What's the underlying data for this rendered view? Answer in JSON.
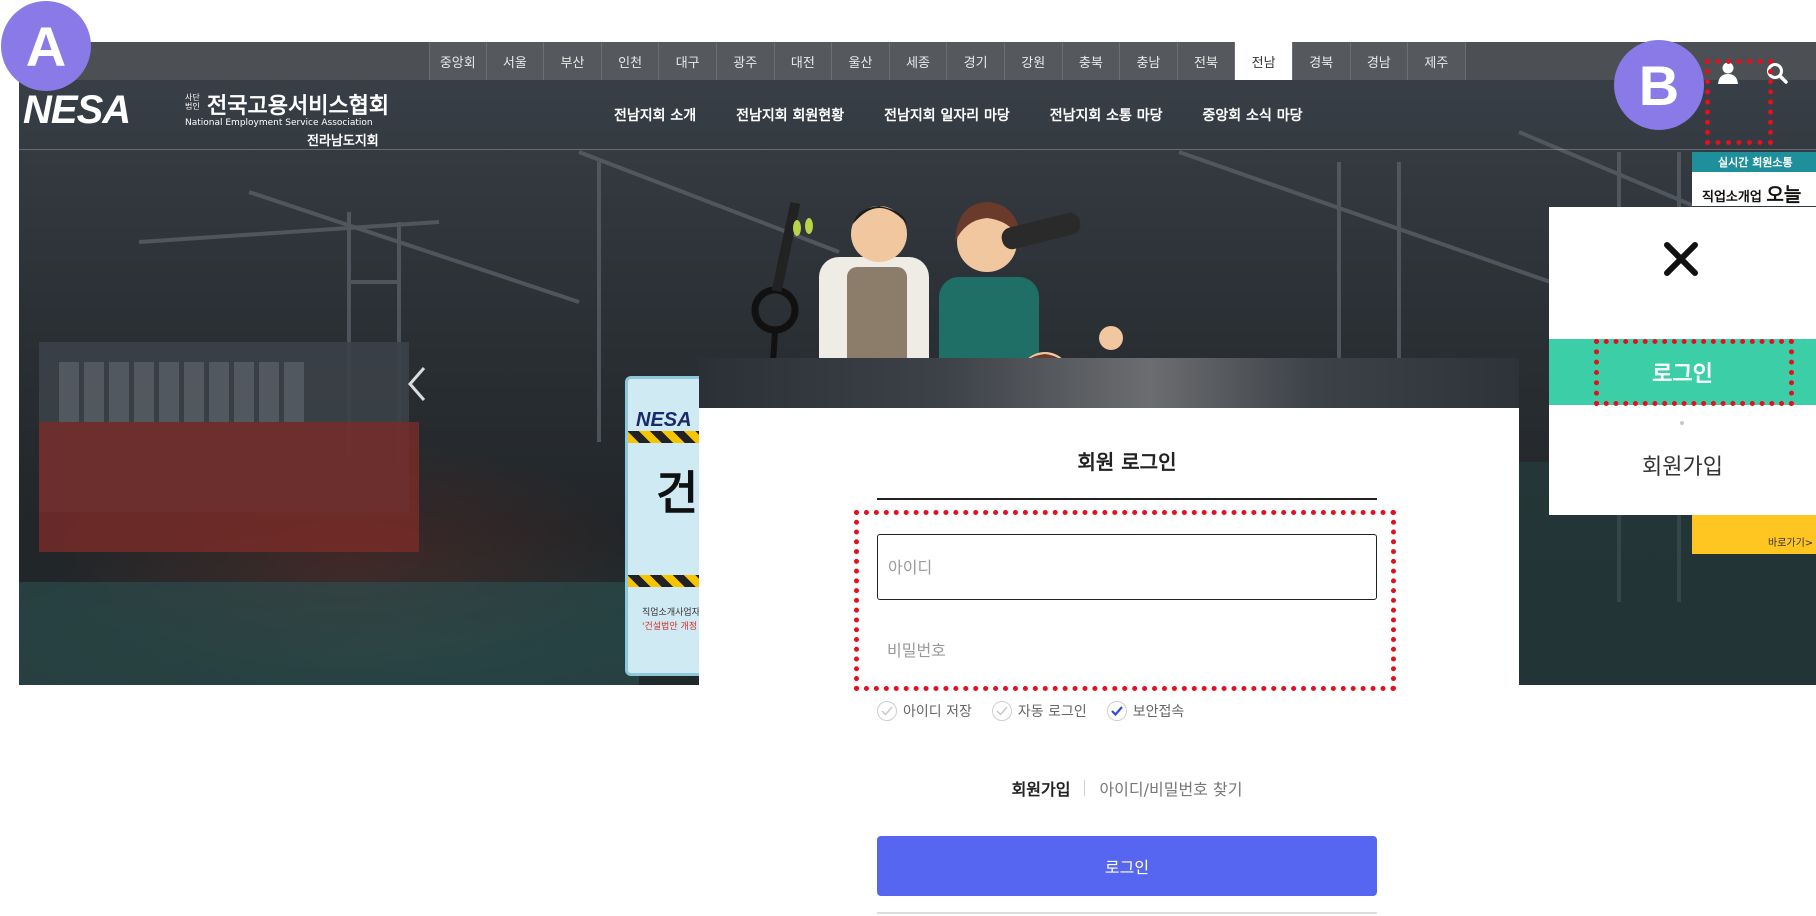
{
  "region_tabs": [
    "중앙회",
    "서울",
    "부산",
    "인천",
    "대구",
    "광주",
    "대전",
    "울산",
    "세종",
    "경기",
    "강원",
    "충북",
    "충남",
    "전북",
    "전남",
    "경북",
    "경남",
    "제주"
  ],
  "active_region": "전남",
  "logo": {
    "mark": "NESA",
    "badge": "사단 법인",
    "title": "전국고용서비스협회",
    "subtitle": "National Employment Service Association",
    "branch": "전라남도지회"
  },
  "main_menu": [
    "전남지회 소개",
    "전남지회 회원현황",
    "전남지회 일자리 마당",
    "전남지회 소통 마당",
    "중앙회 소식 마당"
  ],
  "banner": {
    "logo": "NESA",
    "big_text": "건",
    "small_text_1": "직업소개사업자",
    "small_text_2": "'건설법안 개정"
  },
  "realtime": {
    "header": "실시간 회원소통",
    "body_prefix": "직업소개업",
    "body_big": "오늘",
    "yellow_text": "바로가기>"
  },
  "login": {
    "title": "회원 로그인",
    "id_placeholder": "아이디",
    "pw_placeholder": "비밀번호",
    "options": [
      {
        "label": "아이디 저장",
        "checked": false
      },
      {
        "label": "자동 로그인",
        "checked": false
      },
      {
        "label": "보안접속",
        "checked": true
      }
    ],
    "join_link": "회원가입",
    "find_link": "아이디/비밀번호 찾기",
    "login_button": "로그인"
  },
  "user_popup": {
    "login": "로그인",
    "join": "회원가입"
  },
  "markers": {
    "a": "A",
    "b": "B"
  },
  "colors": {
    "accent_blue": "#5766f0",
    "popup_green": "#3ccfa7",
    "annotation_red": "#e3101e",
    "marker_purple": "#8a7ae8"
  },
  "icons": [
    "user-icon",
    "search-icon",
    "chevron-left-icon",
    "close-icon",
    "check-icon"
  ]
}
